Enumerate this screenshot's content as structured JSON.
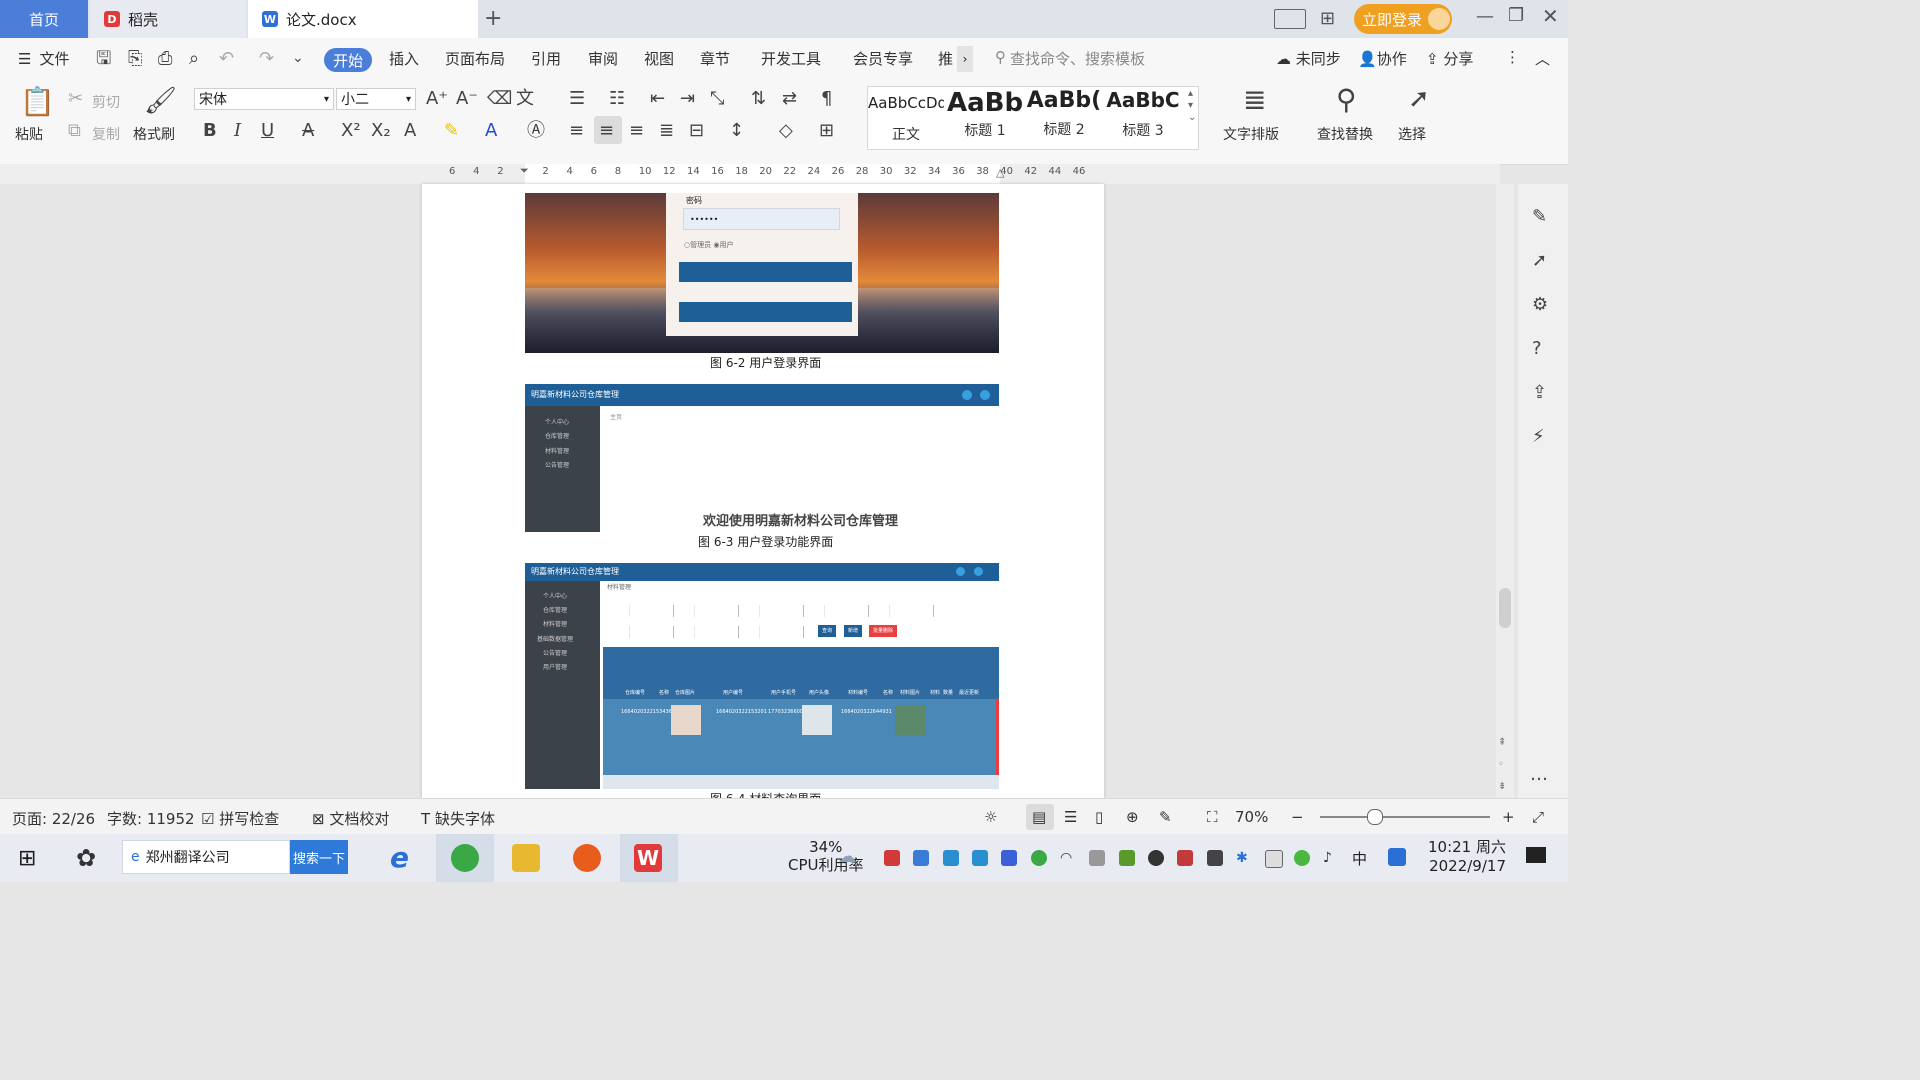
{
  "tabs": {
    "home": "首页",
    "daoke": "稻壳",
    "doc": "论文.docx",
    "login_btn": "立即登录"
  },
  "menu": {
    "file": "文件",
    "items": [
      "开始",
      "插入",
      "页面布局",
      "引用",
      "审阅",
      "视图",
      "章节",
      "开发工具",
      "会员专享",
      "推"
    ],
    "search_placeholder": "查找命令、搜索模板",
    "unsynced": "未同步",
    "collab": "协作",
    "share": "分享"
  },
  "ribbon": {
    "paste": "粘贴",
    "cut": "剪切",
    "copy": "复制",
    "format_painter": "格式刷",
    "font_name": "宋体",
    "font_size": "小二",
    "styles": [
      {
        "sample": "AaBbCcDd",
        "name": "正文"
      },
      {
        "sample": "AaBb",
        "name": "标题 1"
      },
      {
        "sample": "AaBb(",
        "name": "标题 2"
      },
      {
        "sample": "AaBbC",
        "name": "标题 3"
      }
    ],
    "text_layout": "文字排版",
    "find_replace": "查找替换",
    "select": "选择"
  },
  "ruler": [
    "6",
    "4",
    "2",
    "2",
    "4",
    "6",
    "8",
    "10",
    "12",
    "14",
    "16",
    "18",
    "20",
    "22",
    "24",
    "26",
    "28",
    "30",
    "32",
    "34",
    "36",
    "38",
    "40",
    "42",
    "44",
    "46"
  ],
  "document": {
    "fig1": {
      "password_label": "密码",
      "password_value": "••••••",
      "radio_admin": "管理员",
      "radio_user": "用户",
      "caption": "图 6-2 用户登录界面"
    },
    "fig2": {
      "app_title": "明嘉新材料公司仓库管理",
      "menu": [
        "个人中心",
        "仓库管理",
        "材料管理",
        "公告管理"
      ],
      "breadcrumb": "主页",
      "welcome": "欢迎使用明嘉新材料公司仓库管理",
      "caption": "图 6-3 用户登录功能界面"
    },
    "fig3": {
      "app_title": "明嘉新材料公司仓库管理",
      "menu": [
        "个人中心",
        "仓库管理",
        "材料管理",
        "基础数据管理",
        "公告管理",
        "用户管理"
      ],
      "section": "材料管理",
      "buttons": [
        "查询",
        "新增",
        "批量删除"
      ],
      "headers": [
        "仓库编号",
        "名称",
        "仓库图片",
        "用户编号",
        "用户手机号",
        "用户头像",
        "材料编号",
        "名称",
        "材料图片",
        "材料",
        "数量",
        "最近更新"
      ],
      "row1": [
        "1664020322153436",
        "1664020322153201",
        "17703236600",
        "1664020322644931"
      ],
      "caption": "图 6-4 材料查询界面"
    }
  },
  "status": {
    "page": "页面: 22/26",
    "words": "字数: 11952",
    "spell": "拼写检查",
    "proof": "文档校对",
    "missing_font": "缺失字体",
    "zoom": "70%"
  },
  "taskbar": {
    "search_text": "郑州翻译公司",
    "search_btn": "搜索一下",
    "cpu_percent": "34%",
    "cpu_label": "CPU利用率",
    "ime": "中",
    "time": "10:21 周六",
    "date": "2022/9/17"
  },
  "colors": {
    "accent": "#4a7ed8",
    "app_header": "#1f5f97",
    "sidebar": "#3c4249",
    "table_header": "#2f6ba0",
    "login_orange": "#f0a020"
  }
}
